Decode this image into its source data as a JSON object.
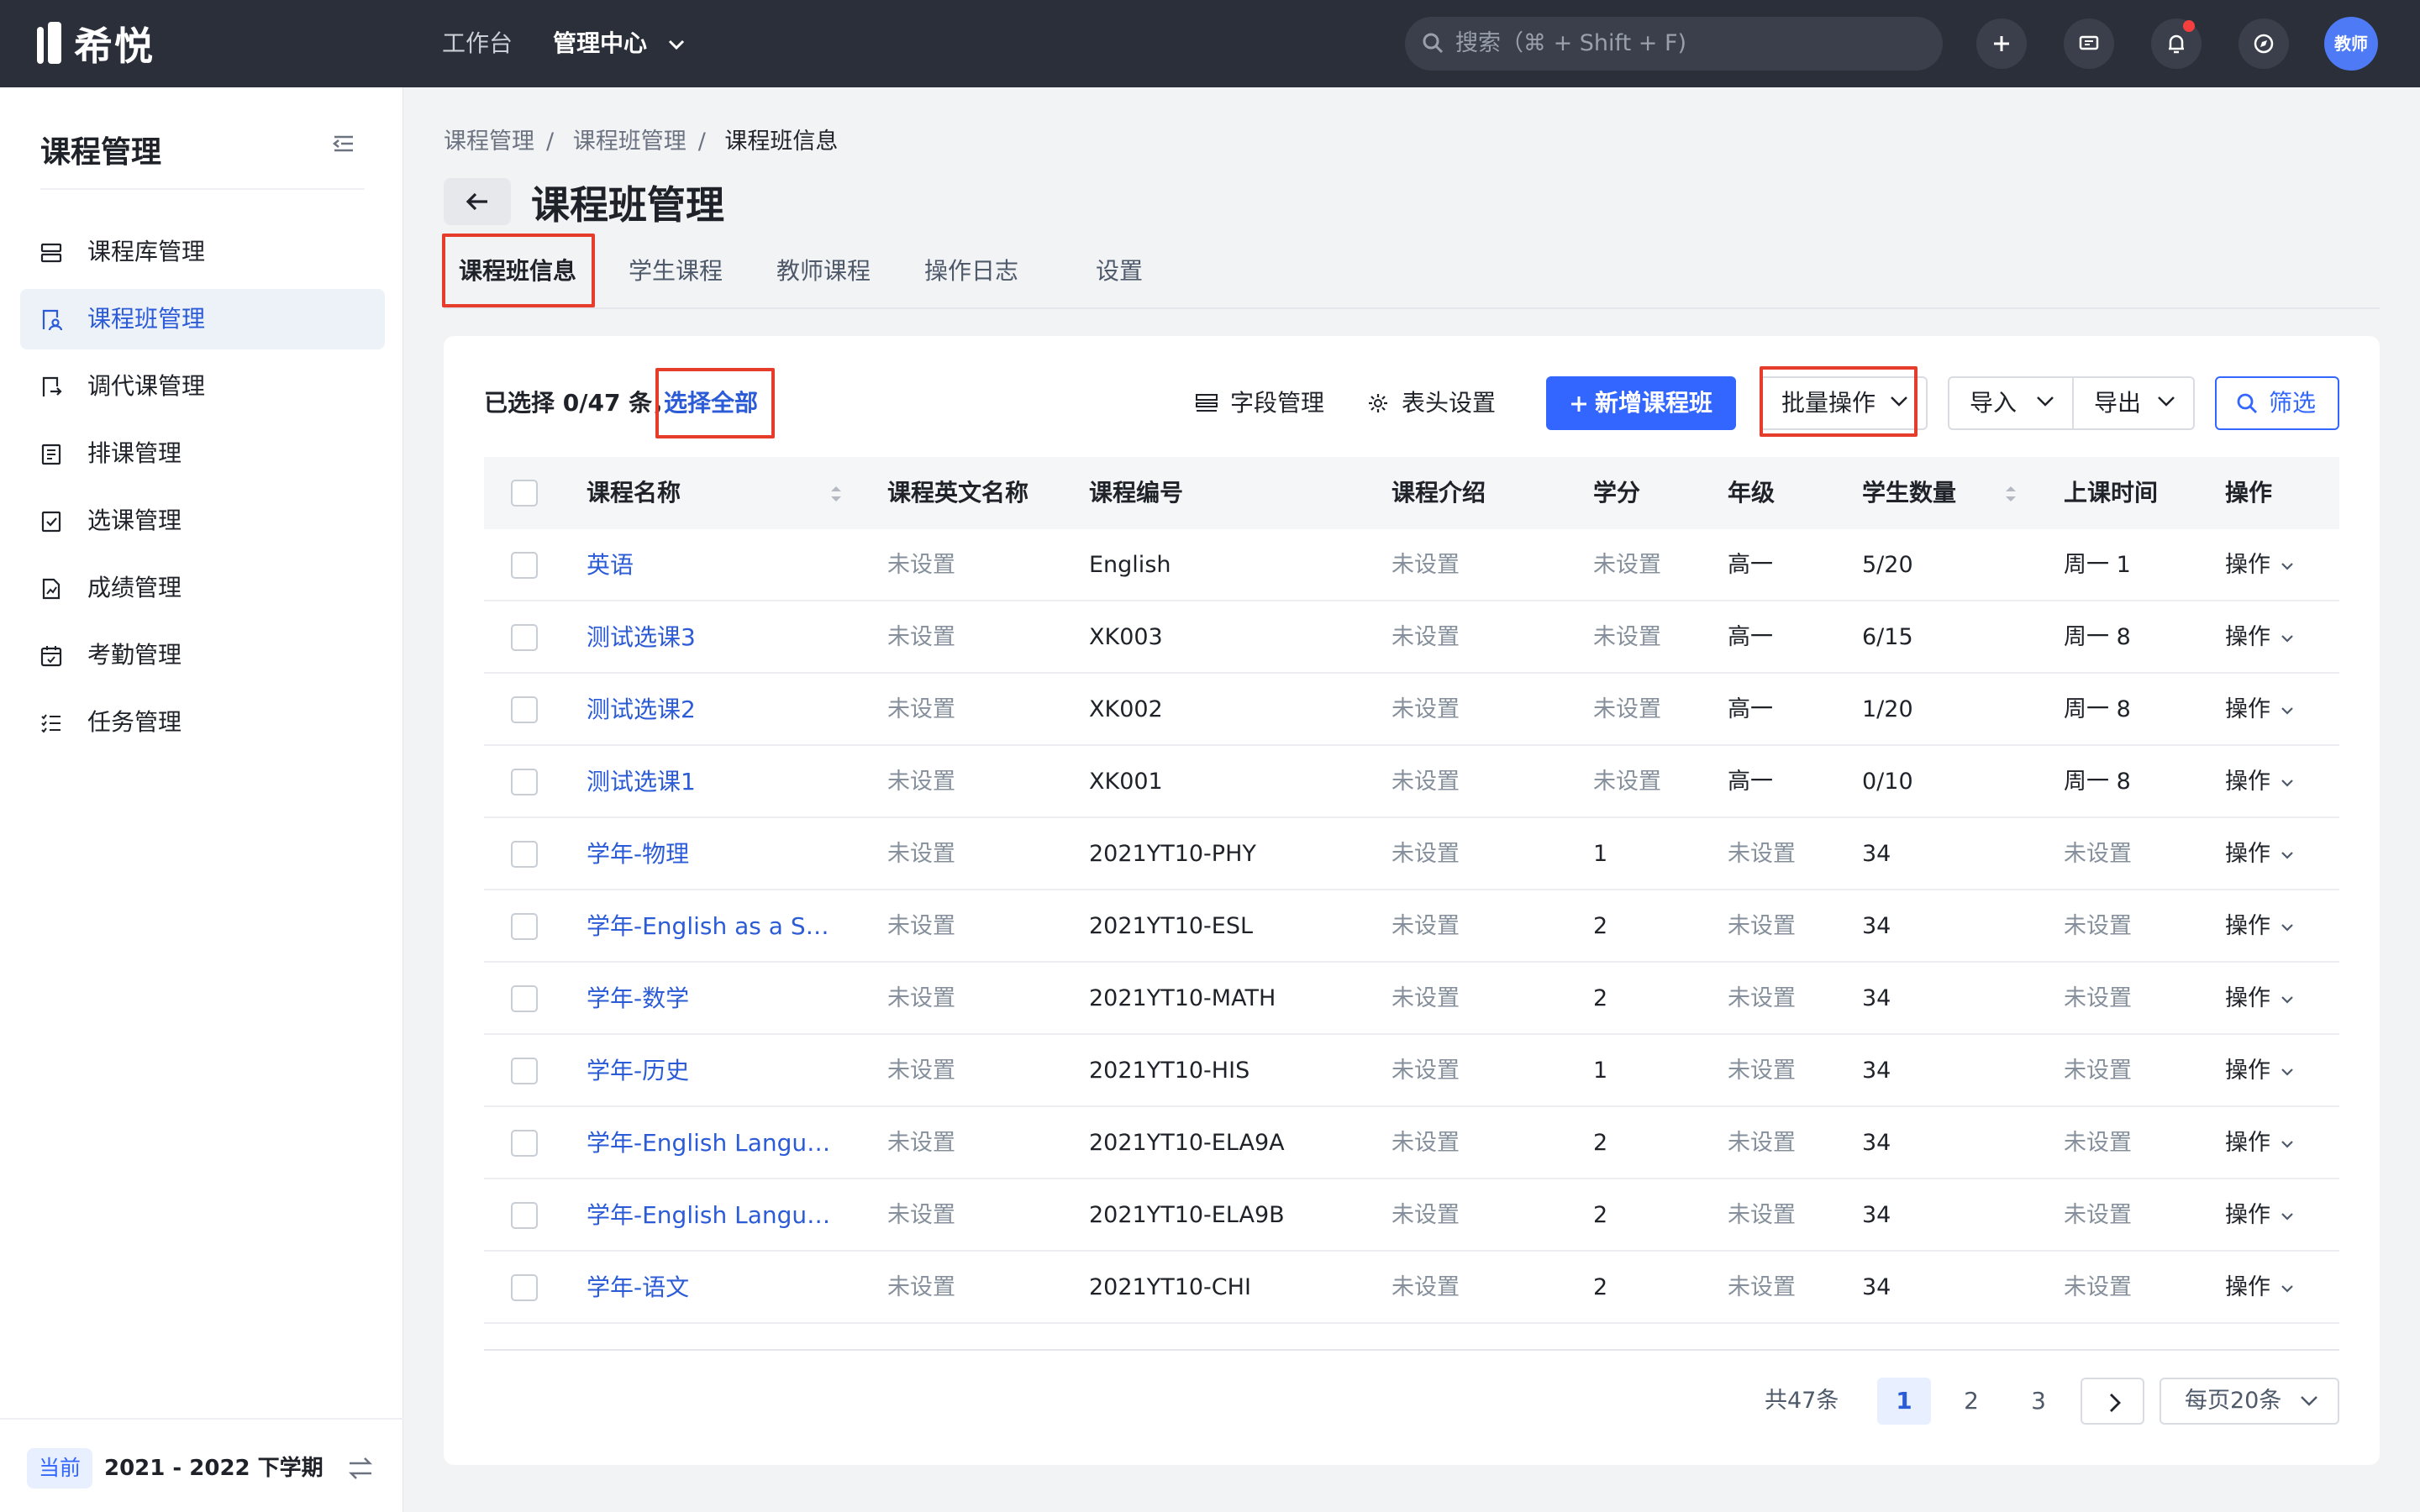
{
  "app": {
    "name": "希悦"
  },
  "topnav": {
    "items": [
      "工作台",
      "管理中心"
    ],
    "search_placeholder": "搜索（⌘ + Shift + F)",
    "avatar_text": "教师"
  },
  "sidebar": {
    "title": "课程管理",
    "items": [
      {
        "label": "课程库管理",
        "icon": "stack-icon"
      },
      {
        "label": "课程班管理",
        "icon": "class-icon",
        "active": true
      },
      {
        "label": "调代课管理",
        "icon": "swap-doc-icon"
      },
      {
        "label": "排课管理",
        "icon": "schedule-icon"
      },
      {
        "label": "选课管理",
        "icon": "check-doc-icon"
      },
      {
        "label": "成绩管理",
        "icon": "grade-icon"
      },
      {
        "label": "考勤管理",
        "icon": "calendar-icon"
      },
      {
        "label": "任务管理",
        "icon": "tasklist-icon"
      }
    ],
    "term_badge": "当前",
    "term": "2021 - 2022 下学期"
  },
  "breadcrumb": [
    "课程管理",
    "课程班管理",
    "课程班信息"
  ],
  "page_title": "课程班管理",
  "tabs": [
    "课程班信息",
    "学生课程",
    "教师课程",
    "操作日志",
    "设置"
  ],
  "toolbar": {
    "selected": "已选择 0/47 条，",
    "select_all": "选择全部",
    "field_manage": "字段管理",
    "header_settings": "表头设置",
    "add": "新增课程班",
    "batch": "批量操作",
    "import": "导入",
    "export": "导出",
    "filter": "筛选"
  },
  "table": {
    "columns": [
      "课程名称",
      "课程英文名称",
      "课程编号",
      "课程介绍",
      "学分",
      "年级",
      "学生数量",
      "上课时间",
      "操作"
    ],
    "rows": [
      [
        "英语",
        "未设置",
        "English",
        "未设置",
        "未设置",
        "高一",
        "5/20",
        "周一 1",
        "操作"
      ],
      [
        "测试选课3",
        "未设置",
        "XK003",
        "未设置",
        "未设置",
        "高一",
        "6/15",
        "周一 8",
        "操作"
      ],
      [
        "测试选课2",
        "未设置",
        "XK002",
        "未设置",
        "未设置",
        "高一",
        "1/20",
        "周一 8",
        "操作"
      ],
      [
        "测试选课1",
        "未设置",
        "XK001",
        "未设置",
        "未设置",
        "高一",
        "0/10",
        "周一 8",
        "操作"
      ],
      [
        "学年-物理",
        "未设置",
        "2021YT10-PHY",
        "未设置",
        "1",
        "未设置",
        "34",
        "未设置",
        "操作"
      ],
      [
        "学年-English as a Sec…",
        "未设置",
        "2021YT10-ESL",
        "未设置",
        "2",
        "未设置",
        "34",
        "未设置",
        "操作"
      ],
      [
        "学年-数学",
        "未设置",
        "2021YT10-MATH",
        "未设置",
        "2",
        "未设置",
        "34",
        "未设置",
        "操作"
      ],
      [
        "学年-历史",
        "未设置",
        "2021YT10-HIS",
        "未设置",
        "1",
        "未设置",
        "34",
        "未设置",
        "操作"
      ],
      [
        "学年-English Languag…",
        "未设置",
        "2021YT10-ELA9A",
        "未设置",
        "2",
        "未设置",
        "34",
        "未设置",
        "操作"
      ],
      [
        "学年-English Languag…",
        "未设置",
        "2021YT10-ELA9B",
        "未设置",
        "2",
        "未设置",
        "34",
        "未设置",
        "操作"
      ],
      [
        "学年-语文",
        "未设置",
        "2021YT10-CHI",
        "未设置",
        "2",
        "未设置",
        "34",
        "未设置",
        "操作"
      ]
    ]
  },
  "pagination": {
    "total": "共47条",
    "pages": [
      "1",
      "2",
      "3"
    ],
    "current": "1",
    "page_size": "每页20条"
  },
  "colors": {
    "topbar": "#2b2f3a",
    "primary": "#3366ff",
    "link": "#2b5bd7",
    "highlight": "#e53c2b",
    "muted": "#86909c"
  }
}
